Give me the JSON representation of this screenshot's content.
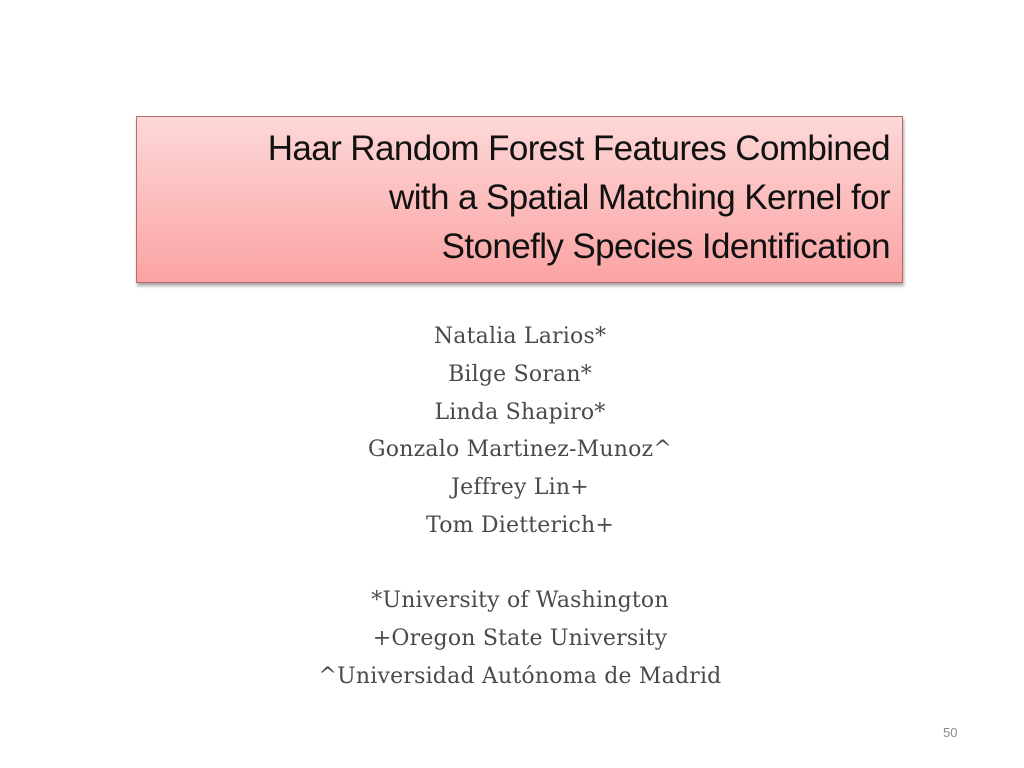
{
  "slide": {
    "title": {
      "lines": [
        "Haar Random Forest Features Combined",
        "with a Spatial Matching Kernel for",
        "Stonefly Species Identification"
      ],
      "box_gradient_top": "#fdd8d8",
      "box_gradient_bottom": "#fba3a3",
      "box_border": "#b96a6a"
    },
    "authors": [
      "Natalia Larios*",
      "Bilge Soran*",
      "Linda Shapiro*",
      "Gonzalo Martinez-Munoz^",
      "Jeffrey Lin+",
      "Tom Dietterich+"
    ],
    "affiliations": [
      "*University of Washington",
      "+Oregon State University",
      "^Universidad Autónoma de Madrid"
    ],
    "page_number": "50",
    "text_color": "#4a4a4a"
  }
}
